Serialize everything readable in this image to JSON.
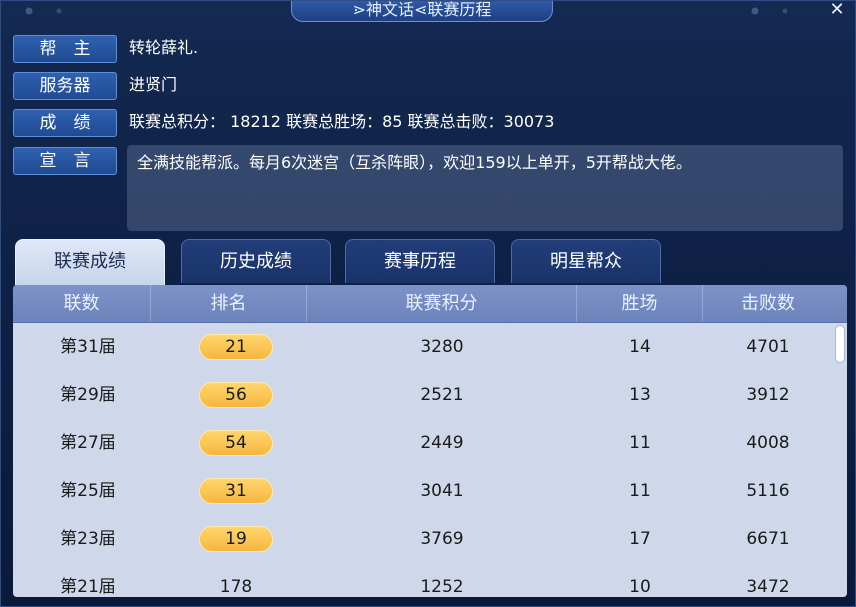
{
  "window": {
    "title": "⋗神文话⋖联赛历程",
    "close_label": "✕"
  },
  "info": {
    "leader": {
      "label": "帮　主",
      "value": "转轮薛礼."
    },
    "server": {
      "label": "服务器",
      "value": "进贤门"
    },
    "achievements": {
      "label": "成　绩",
      "value": "联赛总积分： 18212  联赛总胜场：85  联赛总击败：30073"
    },
    "declaration": {
      "label": "宣　言",
      "value": "全满技能帮派。每月6次迷宫（互杀阵眼），欢迎159以上单开，5开帮战大佬。"
    }
  },
  "tabs": [
    {
      "label": "联赛成绩",
      "active": true
    },
    {
      "label": "历史成绩",
      "active": false
    },
    {
      "label": "赛事历程",
      "active": false
    },
    {
      "label": "明星帮众",
      "active": false
    }
  ],
  "table": {
    "headers": [
      "联数",
      "排名",
      "联赛积分",
      "胜场",
      "击败数"
    ],
    "rows": [
      {
        "season": "第31届",
        "rank": "21",
        "points": "3280",
        "wins": "14",
        "defeats": "4701",
        "highlight": true
      },
      {
        "season": "第29届",
        "rank": "56",
        "points": "2521",
        "wins": "13",
        "defeats": "3912",
        "highlight": true
      },
      {
        "season": "第27届",
        "rank": "54",
        "points": "2449",
        "wins": "11",
        "defeats": "4008",
        "highlight": true
      },
      {
        "season": "第25届",
        "rank": "31",
        "points": "3041",
        "wins": "11",
        "defeats": "5116",
        "highlight": true
      },
      {
        "season": "第23届",
        "rank": "19",
        "points": "3769",
        "wins": "17",
        "defeats": "6671",
        "highlight": true
      },
      {
        "season": "第21届",
        "rank": "178",
        "points": "1252",
        "wins": "10",
        "defeats": "3472",
        "highlight": false
      }
    ]
  },
  "colors": {
    "accent": "#2f61b0",
    "badge": "#f5b640",
    "table_bg": "#cfd8ea"
  }
}
